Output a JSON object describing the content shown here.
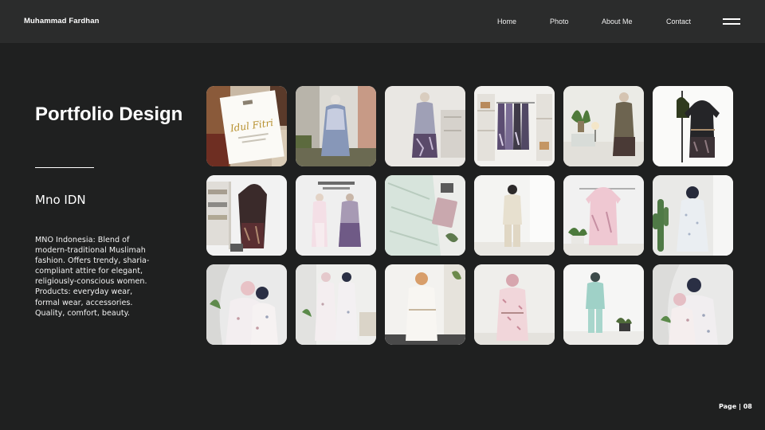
{
  "header": {
    "brand": "Muhammad Fardhan",
    "nav": [
      "Home",
      "Photo",
      "About Me",
      "Contact"
    ],
    "menu_icon": "hamburger-menu-icon"
  },
  "main": {
    "title": "Portfolio Design",
    "client": "Mno IDN",
    "description": "MNO Indonesia: Blend of modern-traditional Muslimah fashion. Offers trendy, sharia-compliant attire for elegant, religiously-conscious women. Products: everyday wear, formal wear, accessories. Quality, comfort, beauty."
  },
  "gallery": {
    "rows": 3,
    "columns": 6,
    "tile_1_card_text": "Idul Fitri"
  },
  "footer": {
    "page_label": "Page | 08"
  },
  "colors": {
    "background": "#1f2020",
    "header_bar": "#2b2c2c",
    "text": "#ffffff"
  }
}
